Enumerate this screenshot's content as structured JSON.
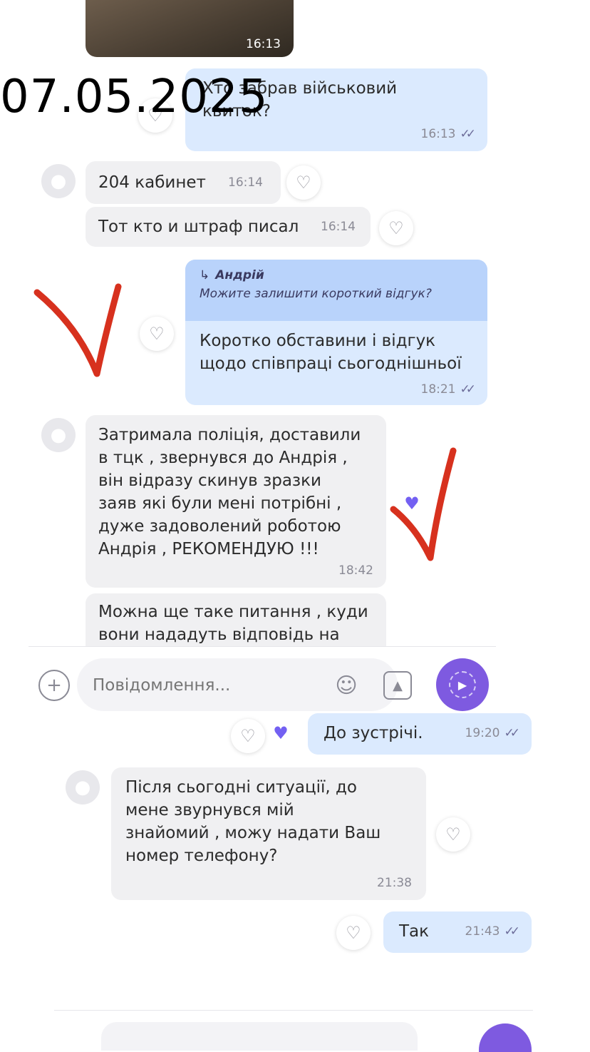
{
  "overlay_date": "07.05.2025",
  "image_message": {
    "time": "16:13"
  },
  "messages": [
    {
      "text_lines": [
        "Хто забрав військовий",
        "квиток?"
      ],
      "time": "16:13"
    },
    {
      "text": "204 кабинет",
      "time": "16:14"
    },
    {
      "text": "Тот кто и штраф писал",
      "time": "16:14"
    },
    {
      "quote_author": "Андрій",
      "quote_text": "Можите залишити короткий відгук?",
      "text_lines": [
        "Коротко обставини і відгук",
        "щодо співпраці сьогоднішньої"
      ],
      "time": "18:21"
    },
    {
      "text_lines": [
        "Затримала поліція, доставили",
        "в тцк , звернувся до Андрія ,",
        "він відразу скинув зразки",
        "заяв які були мені потрібні  ,",
        "дуже задоволений роботою",
        "Андрія , РЕКОМЕНДУЮ !!!"
      ],
      "time": "18:42"
    },
    {
      "text_lines": [
        "Можна ще таке питання , куди",
        "вони нададуть відповідь на"
      ]
    },
    {
      "text": "До зустрічі.",
      "time": "19:20"
    },
    {
      "text_lines": [
        "Після сьогодні ситуації, до",
        "мене звурнувся мій",
        "знайомий , можу надати Ваш",
        "номер телефону?"
      ],
      "time": "21:38"
    },
    {
      "text": "Так",
      "time": "21:43"
    }
  ],
  "input": {
    "placeholder": "Повідомлення..."
  },
  "icons": {
    "add": "plus-icon",
    "emoji": "emoji-icon",
    "gallery": "gallery-icon",
    "send": "send-icon",
    "avatar": "avatar-icon",
    "like": "heart-icon",
    "read": "double-check-icon"
  },
  "colors": {
    "accent": "#7360f2",
    "outgoing": "#dbeafe",
    "incoming": "#f0f0f2",
    "annotation": "#d7311e"
  }
}
